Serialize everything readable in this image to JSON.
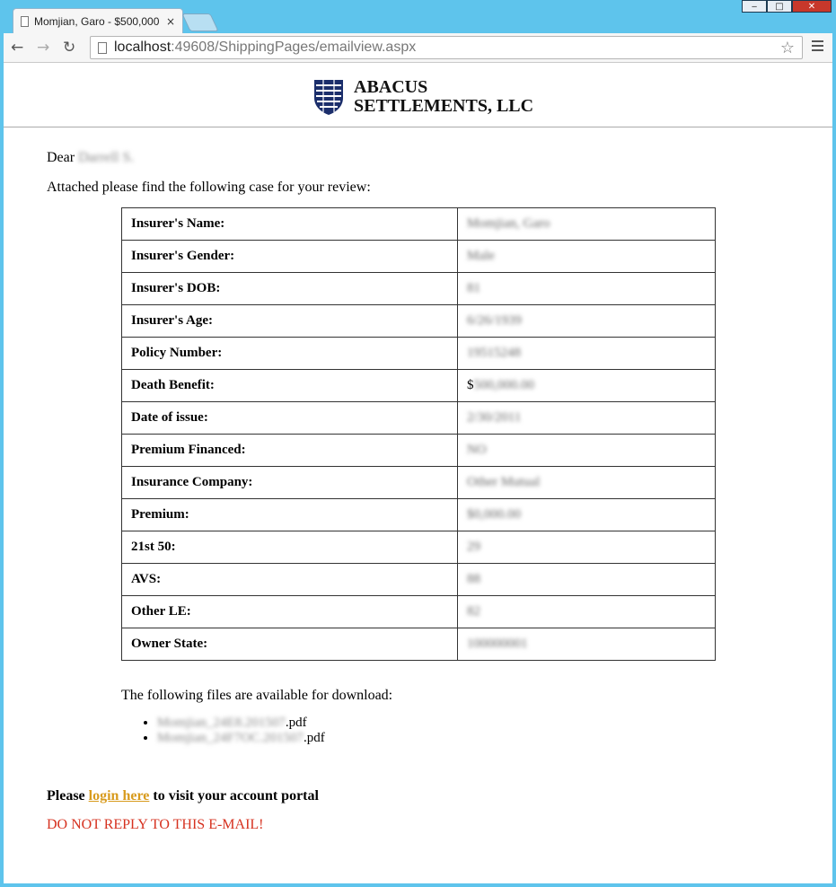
{
  "browser": {
    "tab_title": "Momjian, Garo - $500,000",
    "tab_close": "×",
    "url_host": "localhost",
    "url_path": ":49608/ShippingPages/emailview.aspx",
    "back_glyph": "←",
    "forward_glyph": "→",
    "reload_glyph": "↻",
    "star_glyph": "☆",
    "win_min": "‒",
    "win_max": "□",
    "win_close": "✕"
  },
  "logo": {
    "line1": "ABACUS",
    "line2": "SETTLEMENTS, LLC"
  },
  "email": {
    "dear_label": "Dear",
    "dear_name": "Darrell S.",
    "intro": "Attached please find the following case for your review:",
    "rows": [
      {
        "label": "Insurer's Name:",
        "value": "Momjian, Garo"
      },
      {
        "label": "Insurer's Gender:",
        "value": "Male"
      },
      {
        "label": "Insurer's DOB:",
        "value": "81"
      },
      {
        "label": "Insurer's Age:",
        "value": "6/26/1939"
      },
      {
        "label": "Policy Number:",
        "value": "19515248"
      },
      {
        "label": "Death Benefit:",
        "value_prefix": "$",
        "value": "500,000.00"
      },
      {
        "label": "Date of issue:",
        "value": "2/30/2011"
      },
      {
        "label": "Premium Financed:",
        "value": "NO"
      },
      {
        "label": "Insurance Company:",
        "value": "Other Mutual"
      },
      {
        "label": "Premium:",
        "value": "$0,000.00"
      },
      {
        "label": "21st 50:",
        "value": "29"
      },
      {
        "label": "AVS:",
        "value": "88"
      },
      {
        "label": "Other LE:",
        "value": "82"
      },
      {
        "label": "Owner State:",
        "value": "100000001"
      }
    ],
    "files_intro": "The following files are available for download:",
    "files": [
      {
        "name_blurred": "Momjian_24E8.201507",
        "suffix": ".pdf"
      },
      {
        "name_blurred": "Momjian_24F7OC.201507",
        "suffix": ".pdf"
      }
    ],
    "portal_prefix": "Please",
    "portal_link": "login here",
    "portal_suffix": "to visit your account portal",
    "warning": "DO NOT REPLY TO THIS E-MAIL!"
  },
  "colors": {
    "link": "#d89b1d",
    "warning": "#d6311f",
    "chrome_frame": "#5ec4ec"
  }
}
